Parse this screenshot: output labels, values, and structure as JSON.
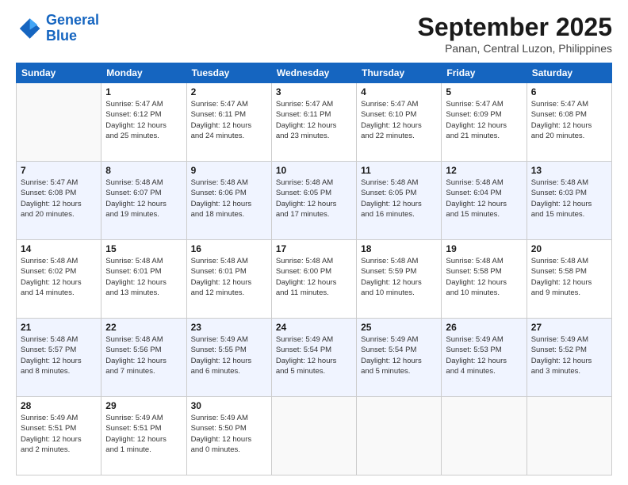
{
  "logo": {
    "line1": "General",
    "line2": "Blue"
  },
  "header": {
    "month": "September 2025",
    "location": "Panan, Central Luzon, Philippines"
  },
  "weekdays": [
    "Sunday",
    "Monday",
    "Tuesday",
    "Wednesday",
    "Thursday",
    "Friday",
    "Saturday"
  ],
  "weeks": [
    [
      {
        "day": "",
        "info": ""
      },
      {
        "day": "1",
        "info": "Sunrise: 5:47 AM\nSunset: 6:12 PM\nDaylight: 12 hours\nand 25 minutes."
      },
      {
        "day": "2",
        "info": "Sunrise: 5:47 AM\nSunset: 6:11 PM\nDaylight: 12 hours\nand 24 minutes."
      },
      {
        "day": "3",
        "info": "Sunrise: 5:47 AM\nSunset: 6:11 PM\nDaylight: 12 hours\nand 23 minutes."
      },
      {
        "day": "4",
        "info": "Sunrise: 5:47 AM\nSunset: 6:10 PM\nDaylight: 12 hours\nand 22 minutes."
      },
      {
        "day": "5",
        "info": "Sunrise: 5:47 AM\nSunset: 6:09 PM\nDaylight: 12 hours\nand 21 minutes."
      },
      {
        "day": "6",
        "info": "Sunrise: 5:47 AM\nSunset: 6:08 PM\nDaylight: 12 hours\nand 20 minutes."
      }
    ],
    [
      {
        "day": "7",
        "info": "Sunrise: 5:47 AM\nSunset: 6:08 PM\nDaylight: 12 hours\nand 20 minutes."
      },
      {
        "day": "8",
        "info": "Sunrise: 5:48 AM\nSunset: 6:07 PM\nDaylight: 12 hours\nand 19 minutes."
      },
      {
        "day": "9",
        "info": "Sunrise: 5:48 AM\nSunset: 6:06 PM\nDaylight: 12 hours\nand 18 minutes."
      },
      {
        "day": "10",
        "info": "Sunrise: 5:48 AM\nSunset: 6:05 PM\nDaylight: 12 hours\nand 17 minutes."
      },
      {
        "day": "11",
        "info": "Sunrise: 5:48 AM\nSunset: 6:05 PM\nDaylight: 12 hours\nand 16 minutes."
      },
      {
        "day": "12",
        "info": "Sunrise: 5:48 AM\nSunset: 6:04 PM\nDaylight: 12 hours\nand 15 minutes."
      },
      {
        "day": "13",
        "info": "Sunrise: 5:48 AM\nSunset: 6:03 PM\nDaylight: 12 hours\nand 15 minutes."
      }
    ],
    [
      {
        "day": "14",
        "info": "Sunrise: 5:48 AM\nSunset: 6:02 PM\nDaylight: 12 hours\nand 14 minutes."
      },
      {
        "day": "15",
        "info": "Sunrise: 5:48 AM\nSunset: 6:01 PM\nDaylight: 12 hours\nand 13 minutes."
      },
      {
        "day": "16",
        "info": "Sunrise: 5:48 AM\nSunset: 6:01 PM\nDaylight: 12 hours\nand 12 minutes."
      },
      {
        "day": "17",
        "info": "Sunrise: 5:48 AM\nSunset: 6:00 PM\nDaylight: 12 hours\nand 11 minutes."
      },
      {
        "day": "18",
        "info": "Sunrise: 5:48 AM\nSunset: 5:59 PM\nDaylight: 12 hours\nand 10 minutes."
      },
      {
        "day": "19",
        "info": "Sunrise: 5:48 AM\nSunset: 5:58 PM\nDaylight: 12 hours\nand 10 minutes."
      },
      {
        "day": "20",
        "info": "Sunrise: 5:48 AM\nSunset: 5:58 PM\nDaylight: 12 hours\nand 9 minutes."
      }
    ],
    [
      {
        "day": "21",
        "info": "Sunrise: 5:48 AM\nSunset: 5:57 PM\nDaylight: 12 hours\nand 8 minutes."
      },
      {
        "day": "22",
        "info": "Sunrise: 5:48 AM\nSunset: 5:56 PM\nDaylight: 12 hours\nand 7 minutes."
      },
      {
        "day": "23",
        "info": "Sunrise: 5:49 AM\nSunset: 5:55 PM\nDaylight: 12 hours\nand 6 minutes."
      },
      {
        "day": "24",
        "info": "Sunrise: 5:49 AM\nSunset: 5:54 PM\nDaylight: 12 hours\nand 5 minutes."
      },
      {
        "day": "25",
        "info": "Sunrise: 5:49 AM\nSunset: 5:54 PM\nDaylight: 12 hours\nand 5 minutes."
      },
      {
        "day": "26",
        "info": "Sunrise: 5:49 AM\nSunset: 5:53 PM\nDaylight: 12 hours\nand 4 minutes."
      },
      {
        "day": "27",
        "info": "Sunrise: 5:49 AM\nSunset: 5:52 PM\nDaylight: 12 hours\nand 3 minutes."
      }
    ],
    [
      {
        "day": "28",
        "info": "Sunrise: 5:49 AM\nSunset: 5:51 PM\nDaylight: 12 hours\nand 2 minutes."
      },
      {
        "day": "29",
        "info": "Sunrise: 5:49 AM\nSunset: 5:51 PM\nDaylight: 12 hours\nand 1 minute."
      },
      {
        "day": "30",
        "info": "Sunrise: 5:49 AM\nSunset: 5:50 PM\nDaylight: 12 hours\nand 0 minutes."
      },
      {
        "day": "",
        "info": ""
      },
      {
        "day": "",
        "info": ""
      },
      {
        "day": "",
        "info": ""
      },
      {
        "day": "",
        "info": ""
      }
    ]
  ]
}
